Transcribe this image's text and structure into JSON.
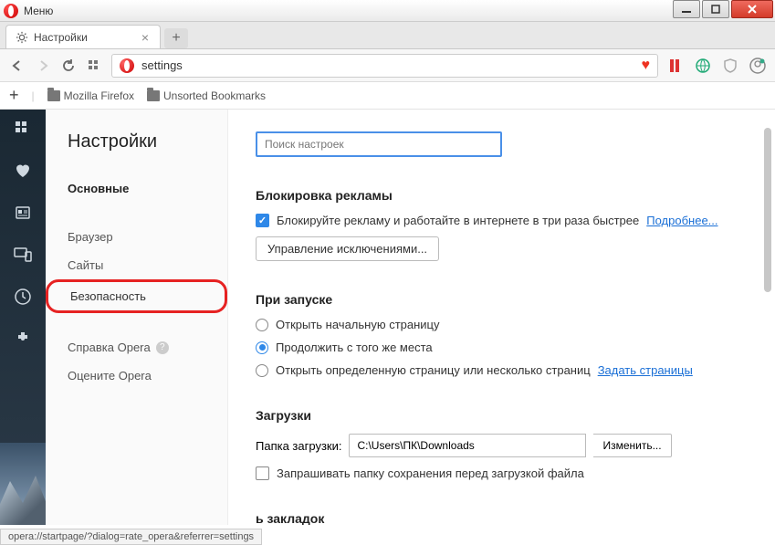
{
  "titlebar": {
    "menu": "Меню"
  },
  "tab": {
    "title": "Настройки"
  },
  "addressbar": {
    "url": "settings"
  },
  "bookmarks": {
    "folder1": "Mozilla Firefox",
    "folder2": "Unsorted Bookmarks"
  },
  "sidebar": {
    "title": "Настройки",
    "basic": "Основные",
    "browser": "Браузер",
    "sites": "Сайты",
    "security": "Безопасность",
    "help": "Справка Opera",
    "rate": "Оцените Opera"
  },
  "content": {
    "search_placeholder": "Поиск настроек",
    "adblock": {
      "heading": "Блокировка рекламы",
      "check_label": "Блокируйте рекламу и работайте в интернете в три раза быстрее",
      "more": "Подробнее...",
      "manage": "Управление исключениями..."
    },
    "startup": {
      "heading": "При запуске",
      "opt1": "Открыть начальную страницу",
      "opt2": "Продолжить с того же места",
      "opt3": "Открыть определенную страницу или несколько страниц",
      "set_pages": "Задать страницы"
    },
    "downloads": {
      "heading": "Загрузки",
      "folder_label": "Папка загрузки:",
      "folder_value": "C:\\Users\\ПК\\Downloads",
      "change": "Изменить...",
      "ask": "Запрашивать папку сохранения перед загрузкой файла"
    },
    "bookmarks_panel": "ь закладок"
  },
  "status": "opera://startpage/?dialog=rate_opera&referrer=settings"
}
